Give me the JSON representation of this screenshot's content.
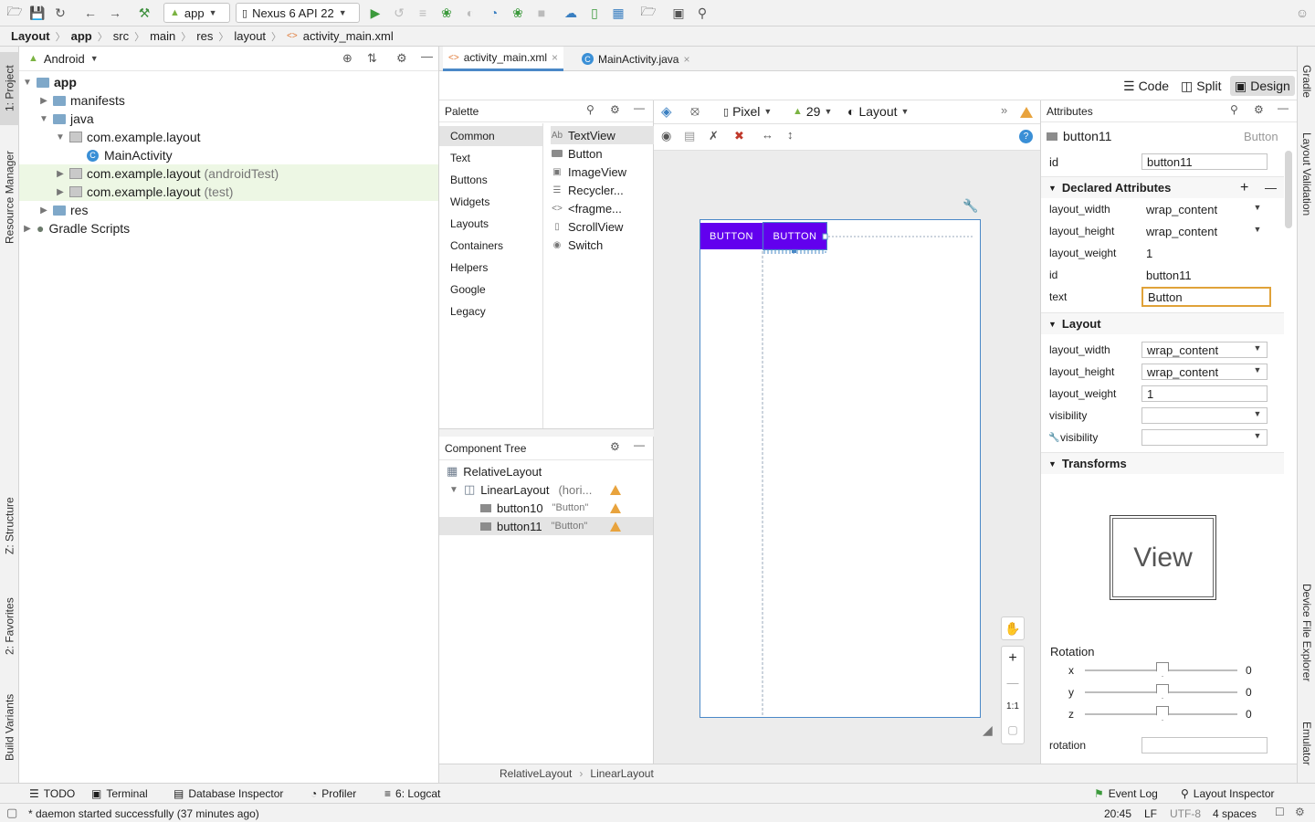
{
  "toolbar": {
    "run_config": "app",
    "device": "Nexus 6 API 22"
  },
  "breadcrumb": [
    "Layout",
    "app",
    "src",
    "main",
    "res",
    "layout",
    "activity_main.xml"
  ],
  "left_strip": {
    "project": "1: Project",
    "resource_manager": "Resource Manager",
    "structure": "Z: Structure",
    "favorites": "2: Favorites",
    "build_variants": "Build Variants"
  },
  "right_strip": {
    "gradle": "Gradle",
    "layout_validation": "Layout Validation",
    "device_file_explorer": "Device File Explorer",
    "emulator": "Emulator"
  },
  "project": {
    "view": "Android",
    "tree": [
      {
        "label": "app",
        "suffix": ""
      },
      {
        "label": "manifests",
        "suffix": ""
      },
      {
        "label": "java",
        "suffix": ""
      },
      {
        "label": "com.example.layout",
        "suffix": ""
      },
      {
        "label": "MainActivity",
        "suffix": ""
      },
      {
        "label": "com.example.layout",
        "suffix": "(androidTest)"
      },
      {
        "label": "com.example.layout",
        "suffix": "(test)"
      },
      {
        "label": "res",
        "suffix": ""
      },
      {
        "label": "Gradle Scripts",
        "suffix": ""
      }
    ]
  },
  "editor_tabs": [
    {
      "label": "activity_main.xml"
    },
    {
      "label": "MainActivity.java"
    }
  ],
  "modes": {
    "code": "Code",
    "split": "Split",
    "design": "Design"
  },
  "palette": {
    "title": "Palette",
    "categories": [
      "Common",
      "Text",
      "Buttons",
      "Widgets",
      "Layouts",
      "Containers",
      "Helpers",
      "Google",
      "Legacy"
    ],
    "items": [
      {
        "icon": "Ab",
        "label": "TextView"
      },
      {
        "icon": "",
        "label": "Button"
      },
      {
        "icon": "",
        "label": "ImageView"
      },
      {
        "icon": "",
        "label": "Recycler..."
      },
      {
        "icon": "<>",
        "label": "<fragme..."
      },
      {
        "icon": "",
        "label": "ScrollView"
      },
      {
        "icon": "",
        "label": "Switch"
      }
    ]
  },
  "component_tree": {
    "title": "Component Tree",
    "rows": [
      {
        "name": "RelativeLayout",
        "detail": ""
      },
      {
        "name": "LinearLayout",
        "detail": "(hori..."
      },
      {
        "name": "button10",
        "detail": "\"Button\""
      },
      {
        "name": "button11",
        "detail": "\"Button\""
      }
    ]
  },
  "design_toolbar": {
    "device": "Pixel",
    "api": "29",
    "theme": "Layout"
  },
  "canvas": {
    "button1": "BUTTON",
    "button2": "BUTTON",
    "zoom_fit": "1:1"
  },
  "layout_crumb": [
    "RelativeLayout",
    "LinearLayout"
  ],
  "attributes": {
    "title": "Attributes",
    "selected": "button11",
    "selected_type": "Button",
    "id_label": "id",
    "id_value": "button11",
    "declared_title": "Declared Attributes",
    "declared": [
      {
        "label": "layout_width",
        "value": "wrap_content"
      },
      {
        "label": "layout_height",
        "value": "wrap_content"
      },
      {
        "label": "layout_weight",
        "value": "1"
      },
      {
        "label": "id",
        "value": "button11"
      },
      {
        "label": "text",
        "value": "Button"
      }
    ],
    "layout_title": "Layout",
    "layout": [
      {
        "label": "layout_width",
        "value": "wrap_content"
      },
      {
        "label": "layout_height",
        "value": "wrap_content"
      },
      {
        "label": "layout_weight",
        "value": "1"
      },
      {
        "label": "visibility",
        "value": ""
      },
      {
        "label": "visibility",
        "value": ""
      }
    ],
    "transforms_title": "Transforms",
    "view_preview": "View",
    "rotation_title": "Rotation",
    "rotation": [
      {
        "axis": "x",
        "value": "0"
      },
      {
        "axis": "y",
        "value": "0"
      },
      {
        "axis": "z",
        "value": "0"
      }
    ],
    "rotation_field_label": "rotation"
  },
  "tool_windows": {
    "todo": "TODO",
    "terminal": "Terminal",
    "database": "Database Inspector",
    "profiler": "Profiler",
    "logcat": "6: Logcat",
    "event_log": "Event Log",
    "layout_inspector": "Layout Inspector"
  },
  "status": {
    "message": "* daemon started successfully (37 minutes ago)",
    "position": "20:45",
    "line_sep": "LF",
    "encoding": "UTF-8",
    "indent": "4 spaces"
  },
  "colors": {
    "button": "#6200ee",
    "selection": "#4a88c7",
    "warning": "#e8a33d",
    "test_highlight": "#edf7e4"
  }
}
